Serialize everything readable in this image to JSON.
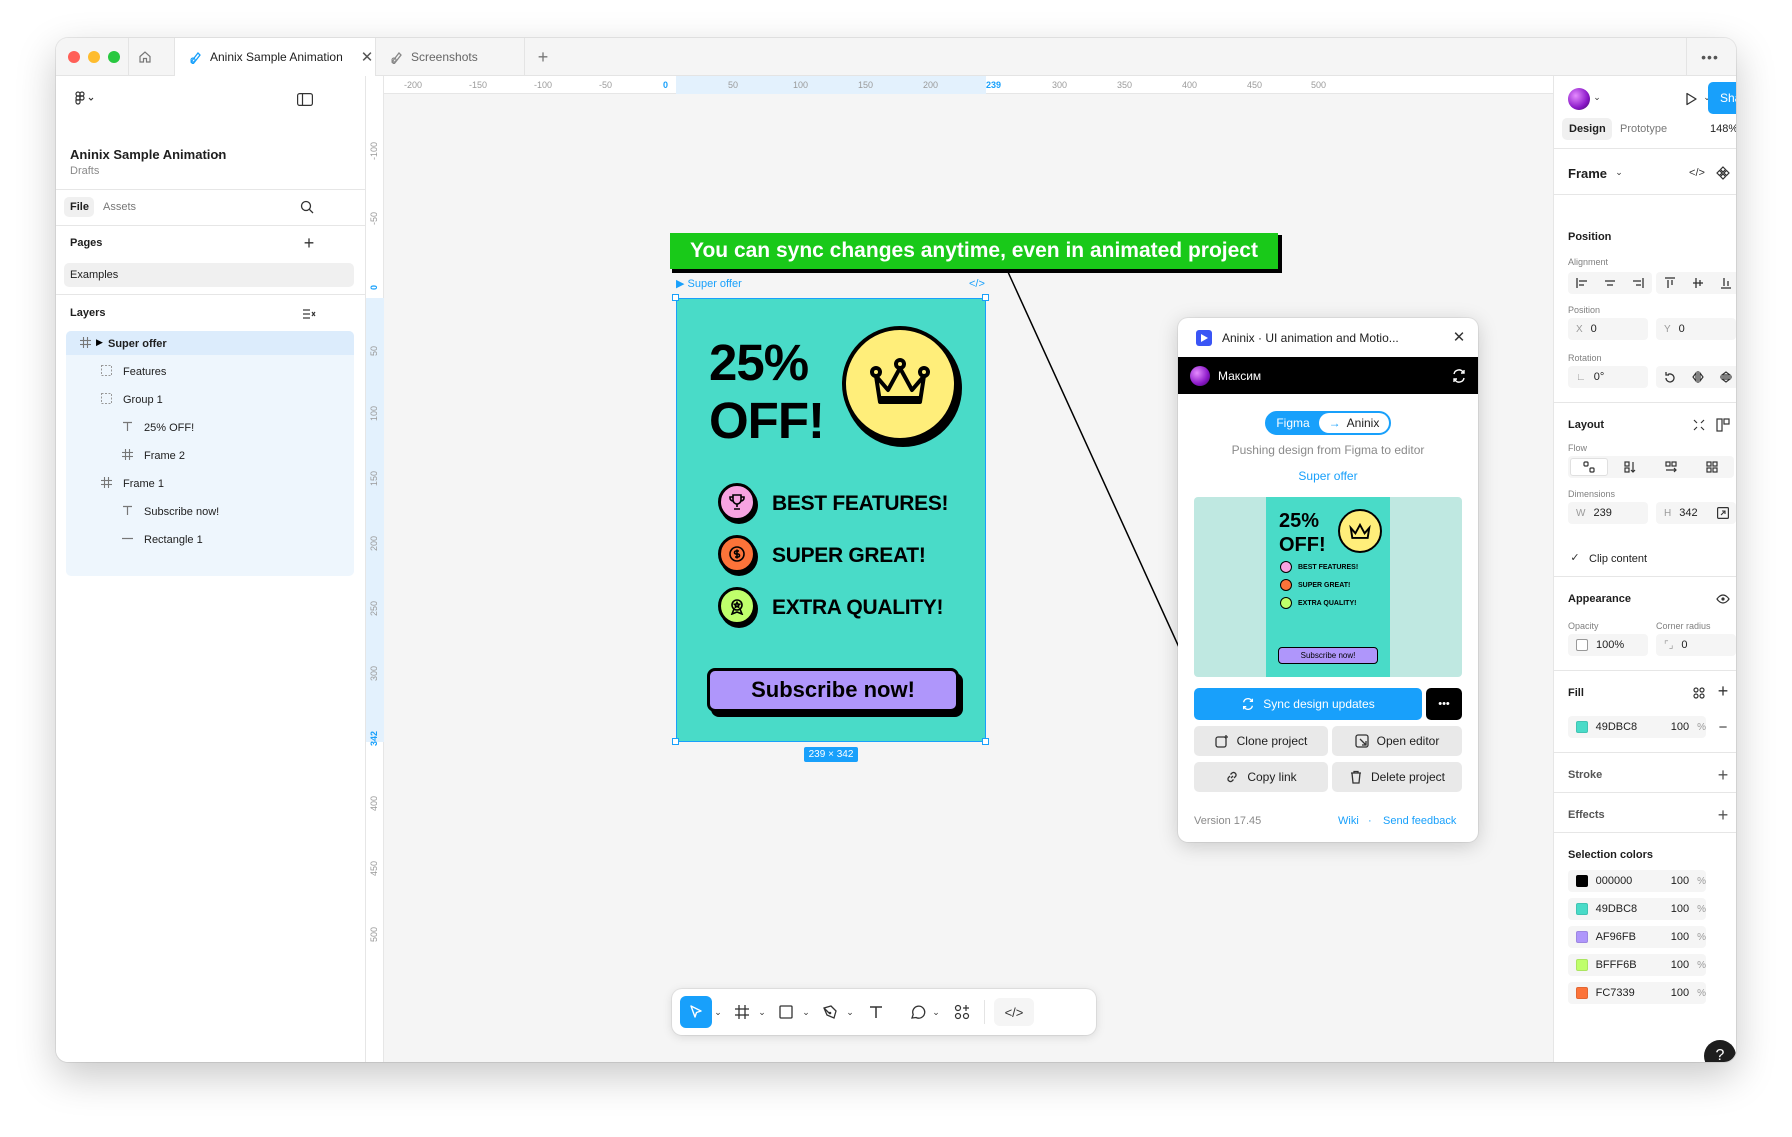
{
  "tabs": {
    "active": "Aninix Sample Animation",
    "other": "Screenshots"
  },
  "file": {
    "name": "Aninix Sample Animation",
    "location": "Drafts",
    "tab_file": "File",
    "tab_assets": "Assets",
    "pages_title": "Pages",
    "page": "Examples",
    "layers_title": "Layers"
  },
  "layers": [
    {
      "name": "Super offer",
      "type": "frame",
      "depth": 0
    },
    {
      "name": "Features",
      "type": "group",
      "depth": 1
    },
    {
      "name": "Group 1",
      "type": "group",
      "depth": 1
    },
    {
      "name": "25% OFF!",
      "type": "text",
      "depth": 2
    },
    {
      "name": "Frame 2",
      "type": "frame",
      "depth": 2
    },
    {
      "name": "Frame 1",
      "type": "frame",
      "depth": 1
    },
    {
      "name": "Subscribe now!",
      "type": "text",
      "depth": 2
    },
    {
      "name": "Rectangle 1",
      "type": "line",
      "depth": 2
    }
  ],
  "ruler": {
    "top": [
      "-200",
      "-150",
      "-100",
      "-50",
      "0",
      "50",
      "100",
      "150",
      "200",
      "239",
      "300",
      "350",
      "400",
      "450",
      "500"
    ],
    "left": [
      "-100",
      "-50",
      "0",
      "50",
      "100",
      "150",
      "200",
      "250",
      "300",
      "342",
      "400",
      "450",
      "500"
    ]
  },
  "canvas": {
    "frame_label": "Super offer",
    "size_badge": "239 × 342",
    "annotation": "You can sync changes anytime, even in animated project"
  },
  "poster": {
    "headline1": "25%",
    "headline2": "OFF!",
    "features": [
      "BEST FEATURES!",
      "SUPER GREAT!",
      "EXTRA QUALITY!"
    ],
    "cta": "Subscribe now!"
  },
  "plugin": {
    "title": "Aninix · UI animation and Motio...",
    "user": "Максим",
    "from": "Figma",
    "to": "Aninix",
    "description": "Pushing design from Figma to editor",
    "frame": "Super offer",
    "preview": {
      "headline1": "25%",
      "headline2": "OFF!",
      "features": [
        "BEST FEATURES!",
        "SUPER GREAT!",
        "EXTRA QUALITY!"
      ],
      "cta": "Subscribe now!"
    },
    "sync": "Sync design updates",
    "clone": "Clone project",
    "open": "Open editor",
    "copy": "Copy link",
    "delete": "Delete project",
    "version": "Version 17.45",
    "wiki": "Wiki",
    "dot": "·",
    "feedback": "Send feedback"
  },
  "right": {
    "share": "Share",
    "tab_design": "Design",
    "tab_prototype": "Prototype",
    "zoom": "148%",
    "frame_title": "Frame",
    "position_title": "Position",
    "alignment": "Alignment",
    "position": "Position",
    "x_label": "X",
    "x": "0",
    "y_label": "Y",
    "y": "0",
    "rotation_label": "Rotation",
    "rotation": "0°",
    "layout_title": "Layout",
    "flow": "Flow",
    "dimensions": "Dimensions",
    "w_label": "W",
    "w": "239",
    "h_label": "H",
    "h": "342",
    "clip": "Clip content",
    "appearance_title": "Appearance",
    "opacity_label": "Opacity",
    "opacity": "100%",
    "radius_label": "Corner radius",
    "radius": "0",
    "fill_title": "Fill",
    "fill_hex": "49DBC8",
    "fill_opacity": "100",
    "pct": "%",
    "stroke_title": "Stroke",
    "effects_title": "Effects",
    "selection_title": "Selection colors",
    "selection_colors": [
      {
        "hex": "000000",
        "opacity": "100",
        "color": "#000000"
      },
      {
        "hex": "49DBC8",
        "opacity": "100",
        "color": "#49DBC8"
      },
      {
        "hex": "AF96FB",
        "opacity": "100",
        "color": "#AF96FB"
      },
      {
        "hex": "BFFF6B",
        "opacity": "100",
        "color": "#BFFF6B"
      },
      {
        "hex": "FC7339",
        "opacity": "100",
        "color": "#FC7339"
      }
    ],
    "help": "?"
  },
  "colors": {
    "accent": "#18a0fb",
    "poster_bg": "#49DBC8",
    "cta": "#AF96FB",
    "annotation": "#19C919",
    "pink": "#f7a3e1",
    "orange": "#FC7339",
    "lime": "#BFFF6B",
    "yellow": "#ffee7a"
  }
}
